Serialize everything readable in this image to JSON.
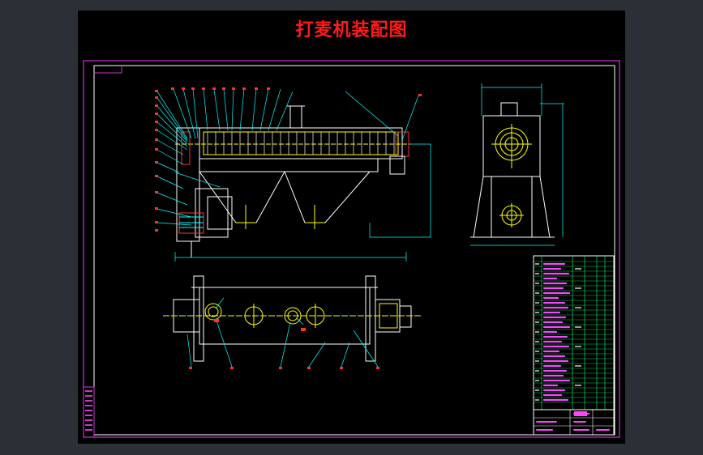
{
  "drawing": {
    "title": "打麦机装配图"
  },
  "colors": {
    "background": "#000000",
    "window": "#2b2f36",
    "frame": "#cc33cc",
    "inner_frame": "#ffffff",
    "title": "#ff1a1a",
    "cyan": "#00ffff",
    "yellow": "#ffff00",
    "red": "#ff3030",
    "green": "#00ff66",
    "magenta": "#ff44ff"
  }
}
